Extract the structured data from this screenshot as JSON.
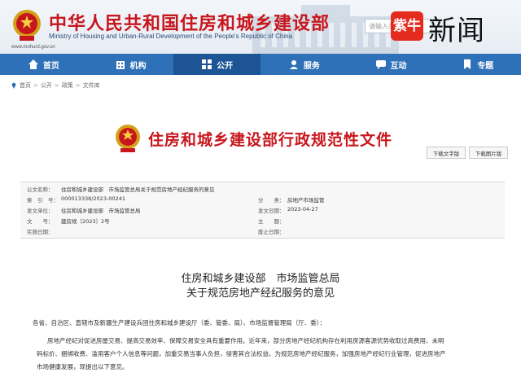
{
  "header": {
    "title": "中华人民共和国住房和城乡建设部",
    "subtitle": "Ministry of Housing and Urban-Rural Development of the People's Republic of China",
    "url": "www.mohurd.gov.cn",
    "search_placeholder": "请输入关键字",
    "news_badge": "紫牛",
    "news_text": "新闻"
  },
  "nav": {
    "items": [
      {
        "label": "首页",
        "icon": "home-icon"
      },
      {
        "label": "机构",
        "icon": "building-icon"
      },
      {
        "label": "公开",
        "icon": "grid-icon"
      },
      {
        "label": "服务",
        "icon": "service-icon"
      },
      {
        "label": "互动",
        "icon": "chat-icon"
      },
      {
        "label": "专题",
        "icon": "bookmark-icon"
      }
    ],
    "active_index": 2
  },
  "breadcrumb": [
    "首页",
    "公开",
    "政策",
    "文件库"
  ],
  "doc": {
    "banner_title": "住房和城乡建设部行政规范性文件",
    "download_text": "下载文字版",
    "download_image": "下载图片版"
  },
  "meta": {
    "rows": [
      {
        "l1": "公文名称：",
        "v1": "住房和城乡建设部　市场监管总局关于规范房地产经纪服务的意见",
        "l2": "",
        "v2": ""
      },
      {
        "l1": "索　引　号：",
        "v1": "000013338/2023-00241",
        "l2": "分　　类：",
        "v2": "房地产市场监管"
      },
      {
        "l1": "发文单位：",
        "v1": "住房和城乡建设部　市场监管总局",
        "l2": "发文日期：",
        "v2": "2023-04-27"
      },
      {
        "l1": "文　　号：",
        "v1": "建房规〔2023〕2号",
        "l2": "主　　题：",
        "v2": ""
      },
      {
        "l1": "实施日期：",
        "v1": "",
        "l2": "废止日期：",
        "v2": ""
      }
    ]
  },
  "article": {
    "title_line1": "住房和城乡建设部　市场监管总局",
    "title_line2": "关于规范房地产经纪服务的意见",
    "salutation": "各省、自治区、直辖市及新疆生产建设兵团住房和城乡建设厅（委、管委、局）、市场监督管理局（厅、委）：",
    "p1_line1": "房地产经纪对促进房屋交易、提高交易效率、保障交易安全具有重要作用。近年来，部分房地产经纪机构存在利用房源客源优势收取过高费用、未明",
    "p1_line2": "码标价、捆绑收费、滥用客户个人信息等问题，加重交易当事人负担，侵害其合法权益。为规范房地产经纪服务，加强房地产经纪行业管理，促进房地产",
    "p1_line3": "市场健康发展，现提出以下意见。"
  },
  "colors": {
    "brand_red": "#c8161d",
    "nav_blue": "#2e71b8",
    "nav_active": "#1c5496"
  }
}
